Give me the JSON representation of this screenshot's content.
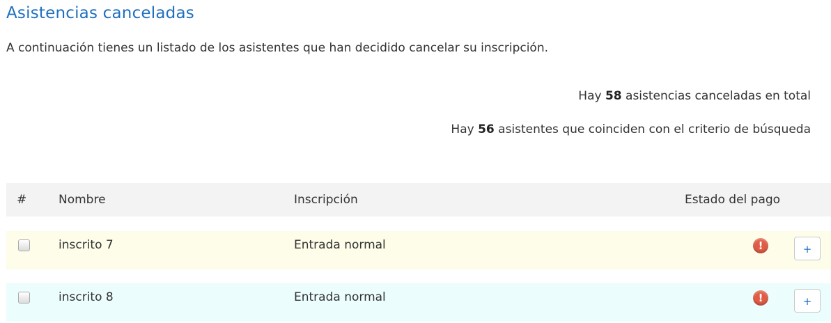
{
  "header": {
    "title": "Asistencias canceladas",
    "intro": "A continuación tienes un listado de los asistentes que han decidido cancelar su inscripción."
  },
  "stats": {
    "total_prefix": "Hay",
    "total_count": "58",
    "total_suffix": "asistencias canceladas en total",
    "match_prefix": "Hay",
    "match_count": "56",
    "match_suffix": "asistentes que coinciden con el criterio de búsqueda"
  },
  "table": {
    "columns": [
      "#",
      "Nombre",
      "Inscripción",
      "Estado del pago"
    ],
    "rows": [
      {
        "checked": false,
        "name": "inscrito 7",
        "inscription": "Entrada normal",
        "payment_status_icon": "alert-icon",
        "action_label": "+",
        "row_color": "#fdfde9"
      },
      {
        "checked": false,
        "name": "inscrito 8",
        "inscription": "Entrada normal",
        "payment_status_icon": "alert-icon",
        "action_label": "+",
        "row_color": "#ecfdfd"
      }
    ]
  },
  "colors": {
    "title": "#1e6fc0",
    "alert": "#e05c45",
    "header_bg": "#f3f3f3"
  }
}
